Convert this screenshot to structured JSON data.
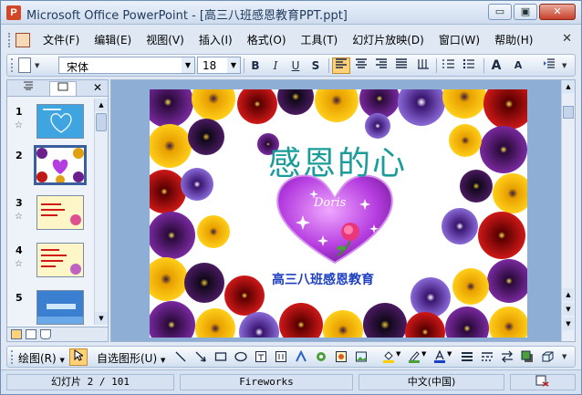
{
  "window": {
    "title": "Microsoft Office PowerPoint - [高三八班感恩教育PPT.ppt]",
    "app_icon_letter": "P",
    "minimize_glyph": "▭",
    "restore_glyph": "▣",
    "close_glyph": "✕"
  },
  "menu": {
    "items": [
      "文件(F)",
      "编辑(E)",
      "视图(V)",
      "插入(I)",
      "格式(O)",
      "工具(T)",
      "幻灯片放映(D)",
      "窗口(W)",
      "帮助(H)"
    ],
    "close_glyph": "✕"
  },
  "format_toolbar": {
    "font_name": "宋体",
    "font_size": "18",
    "bold": "B",
    "italic": "I",
    "underline": "U",
    "shadow": "S",
    "grow_font": "A",
    "shrink_font": "A"
  },
  "panel": {
    "close_glyph": "✕",
    "slides": [
      {
        "number": "1",
        "has_star": true
      },
      {
        "number": "2",
        "has_star": false,
        "selected": true
      },
      {
        "number": "3",
        "has_star": true
      },
      {
        "number": "4",
        "has_star": true
      },
      {
        "number": "5",
        "has_star": false
      }
    ],
    "star_glyph": "☆"
  },
  "slide": {
    "title": "感恩的心",
    "heart_name": "Doris",
    "subtitle": "高三八班感恩教育"
  },
  "draw_toolbar": {
    "draw_label": "绘图(R)",
    "autoshapes_label": "自选图形(U)"
  },
  "status": {
    "slide_position": "幻灯片 2 / 101",
    "design_template": "Fireworks",
    "language": "中文(中国)"
  },
  "colors": {
    "title_teal": "#1a9c9a",
    "subtitle_blue": "#1c3fc1",
    "heart_purple": "#b53ce0",
    "workspace_blue": "#8faed6"
  }
}
